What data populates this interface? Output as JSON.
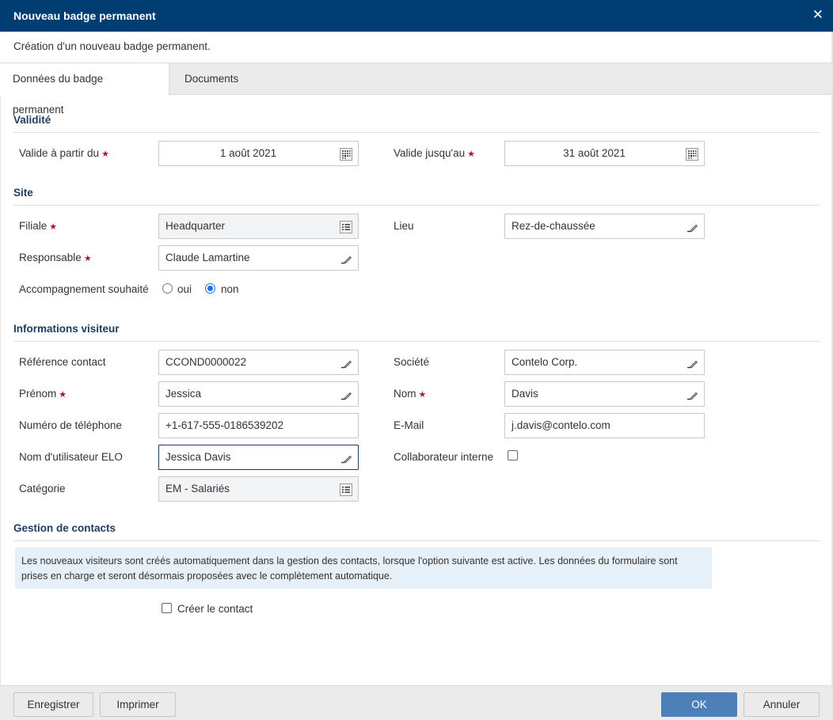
{
  "window": {
    "title": "Nouveau badge permanent",
    "close_icon": "close-icon",
    "subtitle": "Création d'un nouveau badge permanent."
  },
  "tabs": [
    {
      "label": "Données du badge permanent",
      "active": true
    },
    {
      "label": "Documents",
      "active": false
    }
  ],
  "sections": {
    "validity": {
      "title": "Validité",
      "valid_from": {
        "label": "Valide à partir du",
        "required": "★",
        "value": "1 août 2021",
        "icon": "calendar-icon"
      },
      "valid_until": {
        "label": "Valide jusqu'au",
        "required": "★",
        "value": "31 août 2021",
        "icon": "calendar-icon"
      }
    },
    "site": {
      "title": "Site",
      "branch": {
        "label": "Filiale",
        "required": "★",
        "value": "Headquarter",
        "icon": "list-icon"
      },
      "location": {
        "label": "Lieu",
        "value": "Rez-de-chaussée",
        "icon": "edit-icon"
      },
      "responsible": {
        "label": "Responsable",
        "required": "★",
        "value": "Claude Lamartine",
        "icon": "edit-icon"
      },
      "escort": {
        "label": "Accompagnement souhaité",
        "options": [
          "oui",
          "non"
        ],
        "selected": "non"
      }
    },
    "visitor": {
      "title": "Informations visiteur",
      "contact_ref": {
        "label": "Référence contact",
        "value": "CCOND0000022",
        "icon": "edit-icon"
      },
      "company": {
        "label": "Société",
        "value": "Contelo Corp.",
        "icon": "edit-icon"
      },
      "first_name": {
        "label": "Prénom",
        "required": "★",
        "value": "Jessica",
        "icon": "edit-icon"
      },
      "last_name": {
        "label": "Nom",
        "required": "★",
        "value": "Davis",
        "icon": "edit-icon"
      },
      "phone": {
        "label": "Numéro de téléphone",
        "value": "+1-617-555-0186539202"
      },
      "email": {
        "label": "E-Mail",
        "value": "j.davis@contelo.com"
      },
      "elo_user": {
        "label": "Nom d'utilisateur ELO",
        "value": "Jessica Davis",
        "icon": "edit-icon"
      },
      "internal": {
        "label": "Collaborateur interne",
        "checked": false
      },
      "category": {
        "label": "Catégorie",
        "value": "EM - Salariés",
        "icon": "list-icon"
      }
    },
    "contacts": {
      "title": "Gestion de contacts",
      "info": "Les nouveaux visiteurs sont créés automatiquement dans la gestion des contacts, lorsque l'option suivante est active. Les données du formulaire sont prises en charge et seront désormais proposées avec le complètement automatique.",
      "create_contact": {
        "label": "Créer le contact",
        "checked": false
      }
    }
  },
  "footer": {
    "save": "Enregistrer",
    "print": "Imprimer",
    "ok": "OK",
    "cancel": "Annuler"
  },
  "colors": {
    "titlebar": "#003d73",
    "section_title": "#1d3c5f",
    "required": "#a31e22",
    "primary_button": "#4d7fb8",
    "info_box": "#e6f0f8",
    "radio_checked": "#1a73e8"
  }
}
